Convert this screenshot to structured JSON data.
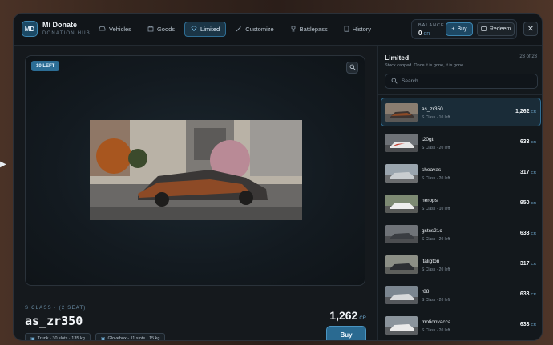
{
  "header": {
    "logo_text": "MD",
    "brand_title": "Mi Donate",
    "brand_sub": "DONATION HUB",
    "nav": [
      {
        "label": "Vehicles",
        "icon": "car-icon"
      },
      {
        "label": "Goods",
        "icon": "box-icon"
      },
      {
        "label": "Limited",
        "icon": "diamond-icon"
      },
      {
        "label": "Customize",
        "icon": "brush-icon"
      },
      {
        "label": "Battlepass",
        "icon": "trophy-icon"
      },
      {
        "label": "History",
        "icon": "document-icon"
      }
    ],
    "active_nav": "Limited",
    "balance_label": "BALANCE",
    "balance_value": "0",
    "balance_unit": "CR",
    "buy_label": "Buy",
    "redeem_label": "Redeem"
  },
  "preview": {
    "badge": "10 LEFT",
    "class_line": "S CLASS · (2 SEAT)",
    "name": "as_zr350",
    "chips": [
      {
        "icon": "box-icon",
        "text": "Trunk - 30 slots · 135 kg"
      },
      {
        "icon": "box-icon",
        "text": "Glovebox - 11 slots · 15 kg"
      }
    ],
    "price": "1,262",
    "price_unit": "CR",
    "buy_label": "Buy"
  },
  "side": {
    "title": "Limited",
    "count": "23 of 23",
    "subtitle": "Stock capped. Once it is gone, it is gone",
    "search_placeholder": "Search...",
    "items": [
      {
        "name": "as_zr350",
        "sub": "S Class · 10 left",
        "price": "1,262",
        "unit": "CR",
        "active": true
      },
      {
        "name": "t20gtr",
        "sub": "S Class · 20 left",
        "price": "633",
        "unit": "CR"
      },
      {
        "name": "sheavas",
        "sub": "S Class · 20 left",
        "price": "317",
        "unit": "CR"
      },
      {
        "name": "nerops",
        "sub": "S Class · 10 left",
        "price": "950",
        "unit": "CR"
      },
      {
        "name": "gstcs21c",
        "sub": "S Class · 20 left",
        "price": "633",
        "unit": "CR"
      },
      {
        "name": "italigton",
        "sub": "S Class · 20 left",
        "price": "317",
        "unit": "CR"
      },
      {
        "name": "r88",
        "sub": "S Class · 20 left",
        "price": "633",
        "unit": "CR"
      },
      {
        "name": "motionvacca",
        "sub": "S Class · 20 left",
        "price": "633",
        "unit": "CR"
      }
    ]
  },
  "colors": {
    "accent": "#2f6d93",
    "panel": "#15191d",
    "currency": "#6fa9cf"
  }
}
